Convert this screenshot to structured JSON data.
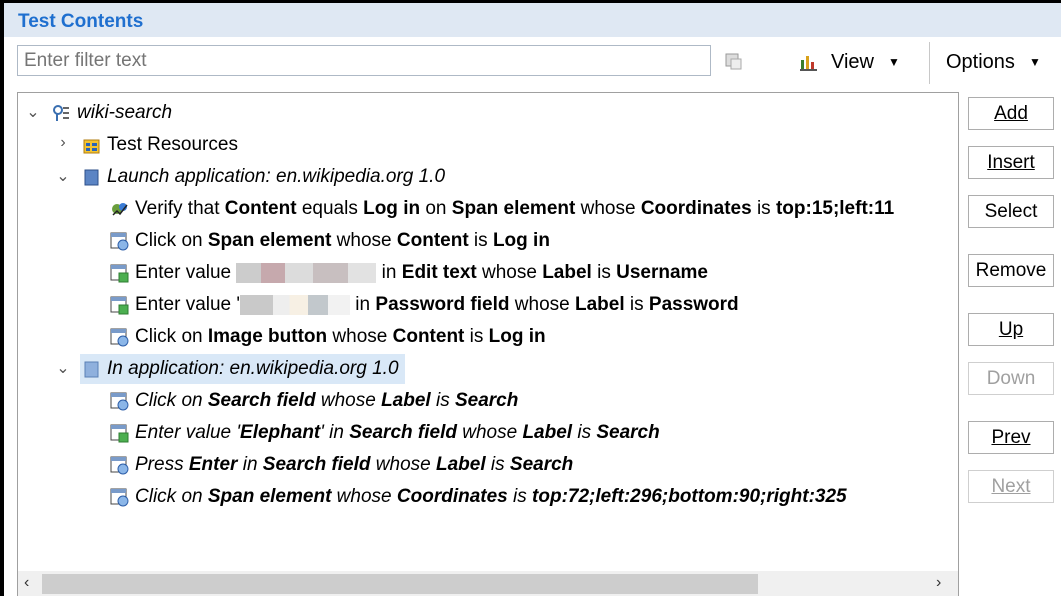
{
  "panel": {
    "title": "Test Contents"
  },
  "toolbar": {
    "filter_placeholder": "Enter filter text",
    "view_label": "View",
    "options_label": "Options"
  },
  "tree": {
    "root": "wiki-search",
    "resources": "Test Resources",
    "launch": "Launch application: en.wikipedia.org  1.0",
    "launch_steps": [
      {
        "p": [
          "Verify that ",
          "Content",
          " equals ",
          "Log in",
          " on ",
          "Span element",
          " whose ",
          "Coordinates",
          " is ",
          "top:15;left:11"
        ]
      },
      {
        "p": [
          "Click on ",
          "Span element",
          " whose ",
          "Content",
          " is ",
          "Log in"
        ]
      },
      {
        "p": [
          "Enter value ",
          "",
          " in ",
          "Edit text",
          " whose ",
          "Label",
          " is ",
          "Username"
        ]
      },
      {
        "p": [
          "Enter value '",
          "",
          " in ",
          "Password field",
          " whose ",
          "Label",
          " is ",
          "Password"
        ]
      },
      {
        "p": [
          "Click on ",
          "Image button",
          " whose ",
          "Content",
          " is ",
          "Log in"
        ]
      }
    ],
    "app": "In application: en.wikipedia.org  1.0",
    "app_steps": [
      {
        "p": [
          "Click on ",
          "Search field",
          " whose ",
          "Label",
          " is ",
          "Search"
        ]
      },
      {
        "p": [
          "Enter value '",
          "Elephant",
          "' in ",
          "Search field",
          " whose ",
          "Label",
          " is ",
          "Search"
        ]
      },
      {
        "p": [
          "Press ",
          "Enter",
          " in ",
          "Search field",
          " whose ",
          "Label",
          " is ",
          "Search"
        ]
      },
      {
        "p": [
          "Click on ",
          "Span element",
          " whose ",
          "Coordinates",
          " is ",
          "top:72;left:296;bottom:90;right:325"
        ]
      }
    ]
  },
  "buttons": {
    "add": "Add",
    "insert": "Insert",
    "select": "Select",
    "remove": "Remove",
    "up": "Up",
    "down": "Down",
    "prev": "Prev",
    "next": "Next"
  }
}
